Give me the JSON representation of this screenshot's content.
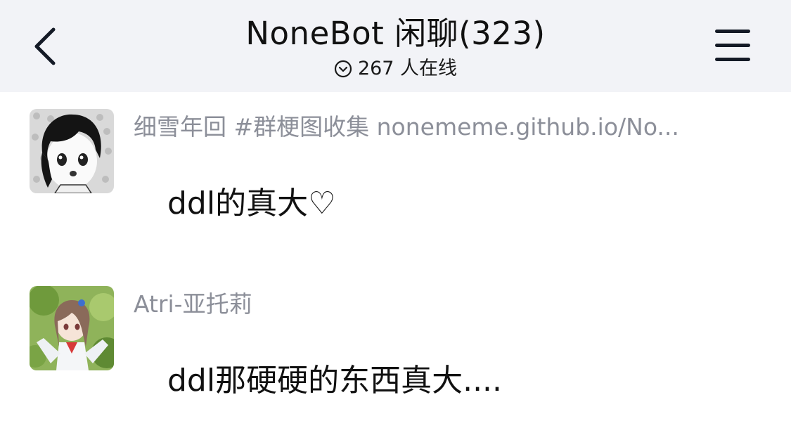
{
  "header": {
    "title": "NoneBot 闲聊(323)",
    "online_text": "267 人在线",
    "back_icon": "chevron-left-icon",
    "menu_icon": "hamburger-menu-icon",
    "online_icon": "chevron-down-circle-icon"
  },
  "messages": [
    {
      "sender": "细雪年回 #群梗图收集 nonememe.github.io/No...",
      "text": "ddl的真大♡",
      "avatar": "manga-girl-avatar"
    },
    {
      "sender": "Atri-亚托莉",
      "text": "ddl那硬硬的东西真大....",
      "avatar": "anime-girl-avatar"
    }
  ],
  "colors": {
    "header_bg": "#f2f3f7",
    "sender_name": "#8c8f99",
    "text": "#111111"
  }
}
